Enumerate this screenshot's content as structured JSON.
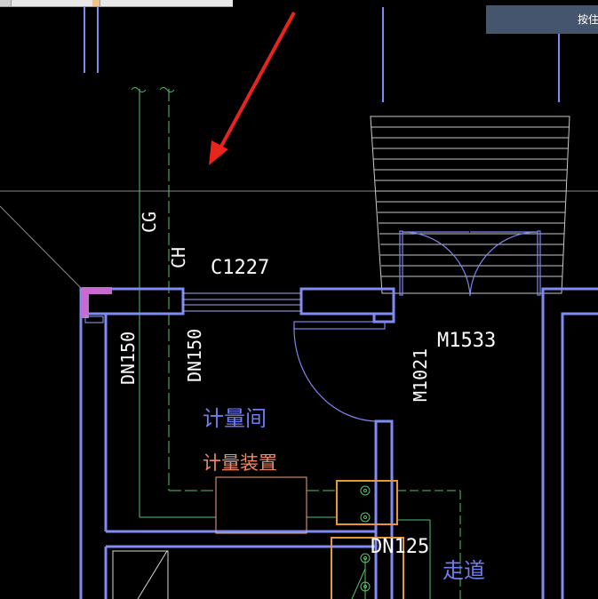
{
  "window": {
    "status_hint": "按住"
  },
  "drawing": {
    "pipe_labels": {
      "cg": "CG",
      "ch": "CH",
      "dn150_left": "DN150",
      "dn150_right": "DN150",
      "dn125": "DN125"
    },
    "window_label": "C1227",
    "door_labels": {
      "main": "M1533",
      "inner": "M1021"
    },
    "room_labels": {
      "metering_room": "计量间",
      "metering_device": "计量装置",
      "corridor": "走道"
    },
    "colors": {
      "wall": "#7f8cf5",
      "pipe": "#56c26a",
      "equipment": "#e8963a",
      "device_outline": "#f3a47c",
      "door_arc": "#7e86ee",
      "room_label": "#6f7df2",
      "device_label": "#ef8a64",
      "annotation": "#ffffff",
      "arrow": "#e8251d",
      "hatch": "#c86ad0"
    }
  }
}
